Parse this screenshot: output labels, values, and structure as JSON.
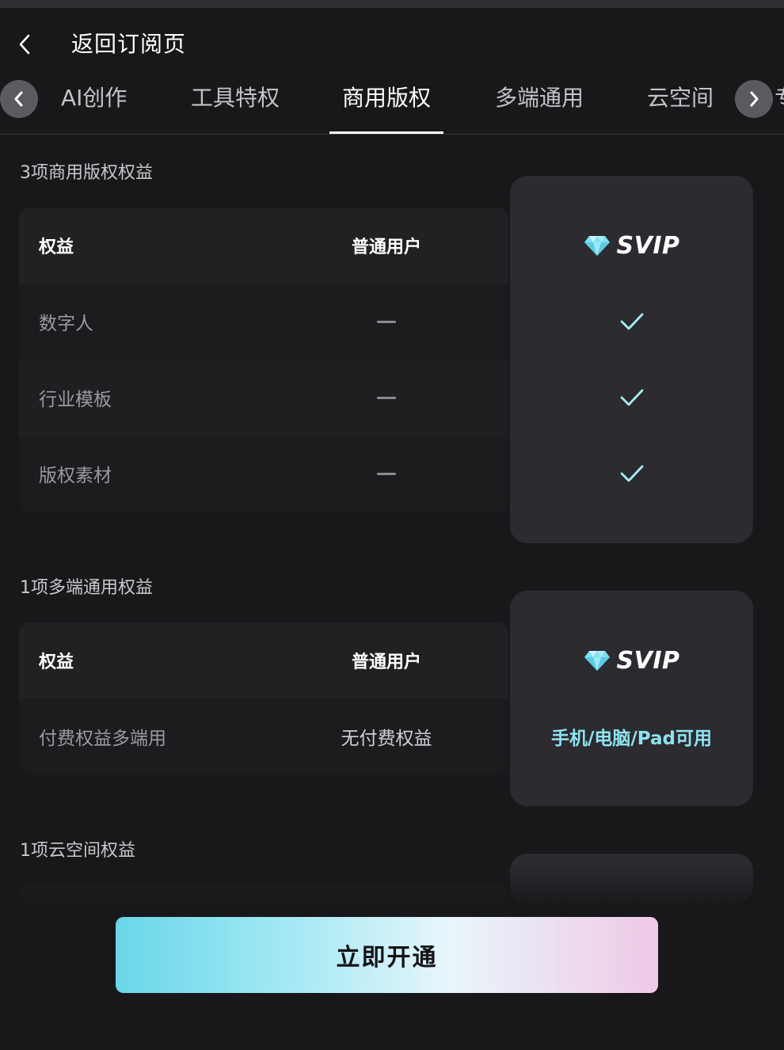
{
  "header": {
    "title": "返回订阅页",
    "back_icon": "chevron-left-icon"
  },
  "tabs": [
    {
      "label": "AI创作",
      "active": false
    },
    {
      "label": "工具特权",
      "active": false
    },
    {
      "label": "商用版权",
      "active": true
    },
    {
      "label": "多端通用",
      "active": false
    },
    {
      "label": "云空间",
      "active": false
    }
  ],
  "tab_peek": "专",
  "sections": [
    {
      "title": "3项商用版权权益",
      "header": {
        "benefit": "权益",
        "normal": "普通用户",
        "svip": "SVIP"
      },
      "rows": [
        {
          "benefit": "数字人",
          "normal": "—",
          "svip": "check"
        },
        {
          "benefit": "行业模板",
          "normal": "—",
          "svip": "check"
        },
        {
          "benefit": "版权素材",
          "normal": "—",
          "svip": "check"
        }
      ]
    },
    {
      "title": "1项多端通用权益",
      "header": {
        "benefit": "权益",
        "normal": "普通用户",
        "svip": "SVIP"
      },
      "rows": [
        {
          "benefit": "付费权益多端用",
          "normal": "无付费权益",
          "svip": "手机/电脑/Pad可用"
        }
      ]
    },
    {
      "title": "1项云空间权益"
    }
  ],
  "cta": {
    "label": "立即开通"
  },
  "colors": {
    "background": "#18181a",
    "svip_value": "#8fe3f0",
    "cta_start": "#6ad6e8",
    "cta_end": "#f0c8e6"
  }
}
